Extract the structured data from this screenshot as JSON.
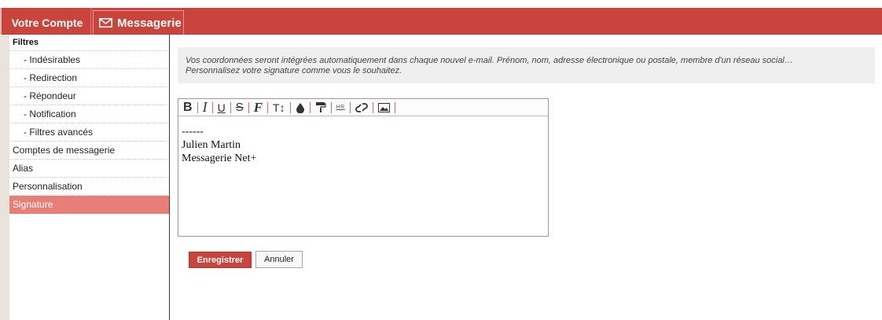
{
  "header": {
    "tab_account": "Votre Compte",
    "tab_mail": "Messagerie",
    "accent_color": "#c8443c"
  },
  "sidebar": {
    "section_title": "Filtres",
    "items": [
      {
        "label": "- Indésirables",
        "type": "sub"
      },
      {
        "label": "- Redirection",
        "type": "sub"
      },
      {
        "label": "- Répondeur",
        "type": "sub"
      },
      {
        "label": "- Notification",
        "type": "sub"
      },
      {
        "label": "- Filtres avancés",
        "type": "sub"
      },
      {
        "label": "Comptes de messagerie",
        "type": "top"
      },
      {
        "label": "Alias",
        "type": "top"
      },
      {
        "label": "Personnalisation",
        "type": "top"
      },
      {
        "label": "Signature",
        "type": "top",
        "active": true
      }
    ],
    "active_color": "#e77f78"
  },
  "info": {
    "line1": "Vos coordonnées seront intégrées automatiquement dans chaque nouvel e-mail. Prénom, nom, adresse électronique ou postale, membre d'un réseau social…",
    "line2": "Personnalisez votre signature comme vous le souhaitez."
  },
  "editor": {
    "toolbar": {
      "bold": "B",
      "italic": "I",
      "underline": "U",
      "strike": "S",
      "font": "F",
      "size": "T↕",
      "hr": "HR",
      "icons": [
        "bold-icon",
        "italic-icon",
        "underline-icon",
        "strikethrough-icon",
        "font-family-icon",
        "font-size-icon",
        "text-color-icon",
        "paint-roller-icon",
        "horizontal-rule-icon",
        "link-icon",
        "image-icon"
      ]
    },
    "content": [
      "------",
      "Julien Martin",
      "Messagerie Net+"
    ]
  },
  "actions": {
    "save_label": "Enregistrer",
    "cancel_label": "Annuler"
  }
}
